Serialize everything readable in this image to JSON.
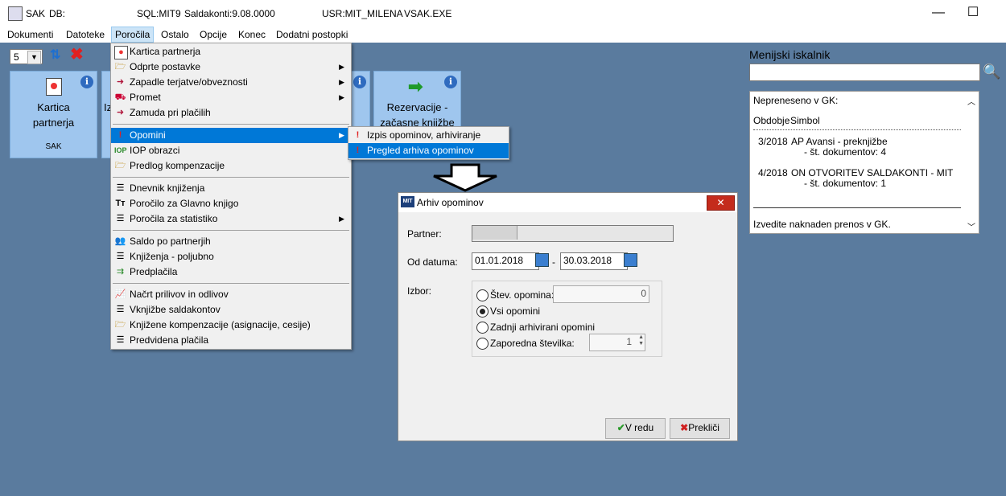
{
  "titlebar": {
    "app": "SAK",
    "db": "DB:",
    "sql": "SQL:MIT9",
    "saldakonti": "Saldakonti:9.08.0000",
    "usr": "USR:MIT_MILENA",
    "exe": "VSAK.EXE",
    "minimize": "—",
    "maximize": "☐"
  },
  "menubar": [
    "Dokumenti",
    "Datoteke",
    "Poročila",
    "Ostalo",
    "Opcije",
    "Konec",
    "Dodatni postopki"
  ],
  "toolbar": {
    "count_value": "5"
  },
  "tiles": [
    {
      "title1": "Kartica",
      "title2": "partnerja",
      "sub": "SAK"
    },
    {
      "title1": "Iz"
    },
    {
      "title1": "Rezervacije -",
      "title2": "začasne knjižbe"
    }
  ],
  "porocila_menu": [
    "Kartica partnerja",
    "Odprte postavke",
    "Zapadle terjatve/obveznosti",
    "Promet",
    "Zamuda pri plačilih",
    "Opomini",
    "IOP obrazci",
    "Predlog kompenzacije",
    "Dnevnik knjiženja",
    "Poročilo za Glavno knjigo",
    "Poročila za statistiko",
    "Saldo po partnerjih",
    "Knjiženja - poljubno",
    "Predplačila",
    "Načrt prilivov in odlivov",
    "Vknjižbe saldakontov",
    "Knjižene kompenzacije (asignacije, cesije)",
    "Predvidena plačila"
  ],
  "opomini_submenu": [
    "Izpis opominov, arhiviranje",
    "Pregled arhiva opominov"
  ],
  "search": {
    "title": "Menijski iskalnik",
    "value": ""
  },
  "gk_panel": {
    "header": "Nepreneseno v GK:",
    "col1": "Obdobje",
    "col2": "Simbol",
    "rows": [
      {
        "period": "3/2018",
        "symbol": "AP Avansi - preknjižbe",
        "docs": "- št. dokumentov: 4"
      },
      {
        "period": "4/2018",
        "symbol": "ON OTVORITEV SALDAKONTI - MIT",
        "docs": "- št. dokumentov: 1"
      }
    ],
    "footer": "Izvedite naknaden prenos v GK."
  },
  "dialog": {
    "title": "Arhiv opominov",
    "partner_label": "Partner:",
    "od_datuma_label": "Od datuma:",
    "date_from": "01.01.2018",
    "date_sep": "-",
    "date_to": "30.03.2018",
    "izbor_label": "Izbor:",
    "stev_opomina_label": "Štev. opomina:",
    "stev_opomina_value": "0",
    "vsi_label": "Vsi opomini",
    "zadnji_label": "Zadnji arhivirani opomini",
    "zaporedna_label": "Zaporedna številka:",
    "zaporedna_value": "1",
    "ok_label": "V redu",
    "cancel_label": "Prekliči"
  },
  "colors": {
    "desktop": "#5a7b9e",
    "tile": "#9fc6ee",
    "highlight": "#0078d7"
  }
}
